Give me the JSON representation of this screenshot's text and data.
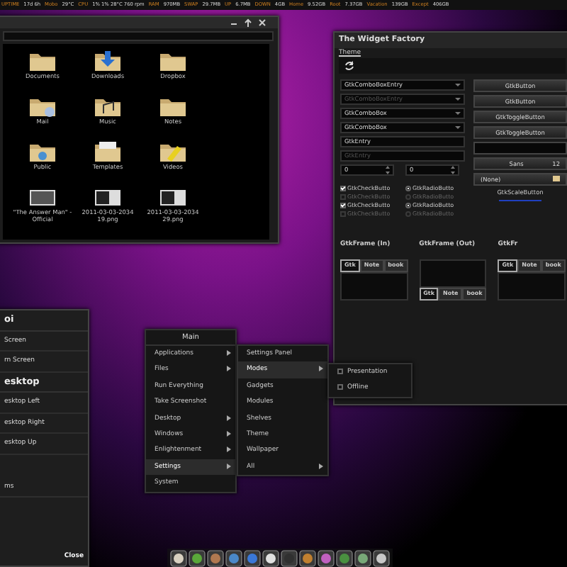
{
  "status_bar": [
    {
      "label": "UPTIME",
      "value": "17d 6h"
    },
    {
      "label": "Mobo",
      "value": "29°C"
    },
    {
      "label": "CPU",
      "value": "1% 1% 28°C 760 rpm"
    },
    {
      "label": "RAM",
      "value": "970MB"
    },
    {
      "label": "SWAP",
      "value": "29.7MB"
    },
    {
      "label": "UP",
      "value": "6.7MB"
    },
    {
      "label": "DOWN",
      "value": "4GB"
    },
    {
      "label": "Home",
      "value": "9.52GB"
    },
    {
      "label": "Root",
      "value": "7.37GB"
    },
    {
      "label": "Vacation",
      "value": "139GB"
    },
    {
      "label": "Except",
      "value": "406GB"
    }
  ],
  "file_manager": {
    "files": [
      {
        "name": "Documents",
        "kind": "folder"
      },
      {
        "name": "Downloads",
        "kind": "downloads"
      },
      {
        "name": "Dropbox",
        "kind": "folder"
      },
      {
        "name": "Mail",
        "kind": "mail"
      },
      {
        "name": "Music",
        "kind": "music"
      },
      {
        "name": "Notes",
        "kind": "folder"
      },
      {
        "name": "Public",
        "kind": "public"
      },
      {
        "name": "Templates",
        "kind": "templates"
      },
      {
        "name": "Videos",
        "kind": "videos"
      },
      {
        "name": "\"The Answer Man\" - Official",
        "kind": "photo"
      },
      {
        "name": "2011-03-03-2034 19.png",
        "kind": "screenshot"
      },
      {
        "name": "2011-03-03-2034 29.png",
        "kind": "screenshot"
      }
    ]
  },
  "widget_factory": {
    "title": "The Widget Factory",
    "menu": [
      "Theme"
    ],
    "combos": [
      {
        "text": "GtkComboBoxEntry",
        "disabled": false
      },
      {
        "text": "GtkComboBoxEntry",
        "disabled": true
      },
      {
        "text": "GtkComboBox",
        "disabled": false
      },
      {
        "text": "GtkComboBox",
        "disabled": false
      }
    ],
    "entries": [
      {
        "text": "GtkEntry",
        "disabled": false
      },
      {
        "text": "GtkEntry",
        "disabled": true
      }
    ],
    "spinners": [
      "0",
      "0"
    ],
    "checks": [
      {
        "label": "GtkCheckButto",
        "checked": true,
        "disabled": false
      },
      {
        "label": "GtkCheckButto",
        "checked": false,
        "disabled": true
      },
      {
        "label": "GtkCheckButto",
        "checked": true,
        "disabled": false
      },
      {
        "label": "GtkCheckButto",
        "checked": false,
        "disabled": true
      }
    ],
    "radios": [
      {
        "label": "GtkRadioButto",
        "selected": true,
        "disabled": false
      },
      {
        "label": "GtkRadioButto",
        "selected": false,
        "disabled": true
      },
      {
        "label": "GtkRadioButto",
        "selected": true,
        "disabled": false
      },
      {
        "label": "GtkRadioButto",
        "selected": false,
        "disabled": true
      }
    ],
    "buttons": [
      "GtkButton",
      "GtkButton"
    ],
    "toggles": [
      {
        "label": "GtkToggleButton",
        "on": false
      },
      {
        "label": "GtkToggleButton",
        "on": false
      }
    ],
    "font_button": {
      "family": "Sans",
      "size": "12"
    },
    "file_chooser": "(None)",
    "scale_button": "GtkScaleButton",
    "frames": [
      {
        "title": "GtkFrame (In)",
        "tabs": [
          {
            "label": "Gtk",
            "selected": true
          },
          {
            "label": "Note",
            "selected": false
          },
          {
            "label": "book",
            "selected": false
          }
        ]
      },
      {
        "title": "GtkFrame (Out)",
        "tabs": [
          {
            "label": "Gtk",
            "selected": true
          },
          {
            "label": "Note",
            "selected": false
          },
          {
            "label": "book",
            "selected": false
          }
        ]
      },
      {
        "title": "GtkFr",
        "tabs": [
          {
            "label": "Gtk",
            "selected": true
          },
          {
            "label": "Note",
            "selected": false
          },
          {
            "label": "book",
            "selected": false
          }
        ]
      }
    ]
  },
  "settings_list": {
    "items": [
      {
        "text": "oi",
        "kind": "heading"
      },
      {
        "text": "Screen",
        "kind": "item"
      },
      {
        "text": "rn Screen",
        "kind": "item"
      },
      {
        "text": "esktop",
        "kind": "heading"
      },
      {
        "text": "esktop Left",
        "kind": "item"
      },
      {
        "text": "esktop Right",
        "kind": "item"
      },
      {
        "text": "esktop Up",
        "kind": "item"
      }
    ],
    "footer": "ms",
    "close": "Close"
  },
  "main_menu": {
    "title": "Main",
    "items": [
      {
        "label": "Applications",
        "submenu": true,
        "selected": false
      },
      {
        "label": "Files",
        "submenu": true,
        "selected": false
      },
      {
        "label": "Run Everything",
        "submenu": false,
        "selected": false
      },
      {
        "label": "Take Screenshot",
        "submenu": false,
        "selected": false
      },
      {
        "label": "Desktop",
        "submenu": true,
        "selected": false
      },
      {
        "label": "Windows",
        "submenu": true,
        "selected": false
      },
      {
        "label": "Enlightenment",
        "submenu": true,
        "selected": false
      },
      {
        "label": "Settings",
        "submenu": true,
        "selected": true
      },
      {
        "label": "System",
        "submenu": false,
        "selected": false
      }
    ]
  },
  "settings_menu": {
    "items": [
      {
        "label": "Settings Panel",
        "submenu": false,
        "selected": false
      },
      {
        "label": "Modes",
        "submenu": true,
        "selected": true
      },
      {
        "label": "Gadgets",
        "submenu": false,
        "selected": false
      },
      {
        "label": "Modules",
        "submenu": false,
        "selected": false
      },
      {
        "label": "Shelves",
        "submenu": false,
        "selected": false
      },
      {
        "label": "Theme",
        "submenu": false,
        "selected": false
      },
      {
        "label": "Wallpaper",
        "submenu": false,
        "selected": false
      },
      {
        "label": "All",
        "submenu": true,
        "selected": false
      }
    ]
  },
  "modes_menu": {
    "items": [
      {
        "label": "Presentation",
        "checked": false
      },
      {
        "label": "Offline",
        "checked": false
      }
    ]
  },
  "dock": [
    {
      "color": "#d8d0c0"
    },
    {
      "color": "#5aa83a"
    },
    {
      "color": "#b07850"
    },
    {
      "color": "#4a88c8"
    },
    {
      "color": "#3a78d8"
    },
    {
      "color": "#e0e0e0"
    },
    {
      "color": "#303030"
    },
    {
      "color": "#c08030"
    },
    {
      "color": "#c060c0"
    },
    {
      "color": "#4a9040"
    },
    {
      "color": "#78a878"
    },
    {
      "color": "#c8c8c8"
    }
  ]
}
